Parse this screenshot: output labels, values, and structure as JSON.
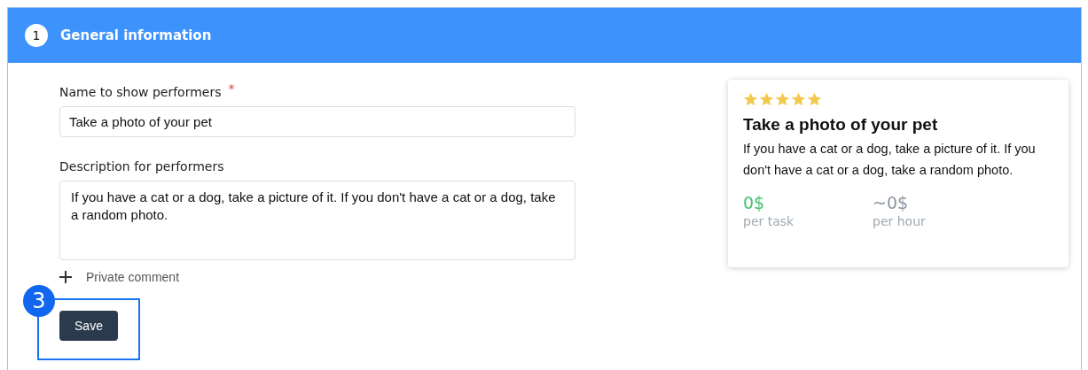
{
  "section": {
    "number": "1",
    "title": "General information"
  },
  "form": {
    "name_label": "Name to show performers",
    "required_mark": "*",
    "name_value": "Take a photo of your pet",
    "description_label": "Description for performers",
    "description_value": "If you have a cat or a dog, take a picture of it. If you don't have a cat or a dog, take a random photo.",
    "private_comment": "Private comment",
    "save": "Save"
  },
  "annotation": {
    "number": "3"
  },
  "preview": {
    "stars": 5,
    "title": "Take a photo of your pet",
    "description": "If you have a cat or a dog, take a picture of it. If you don't have a cat or a dog, take a random photo.",
    "price": "0$",
    "price_caption": "per task",
    "hourly": "~0$",
    "hourly_caption": "per hour"
  }
}
